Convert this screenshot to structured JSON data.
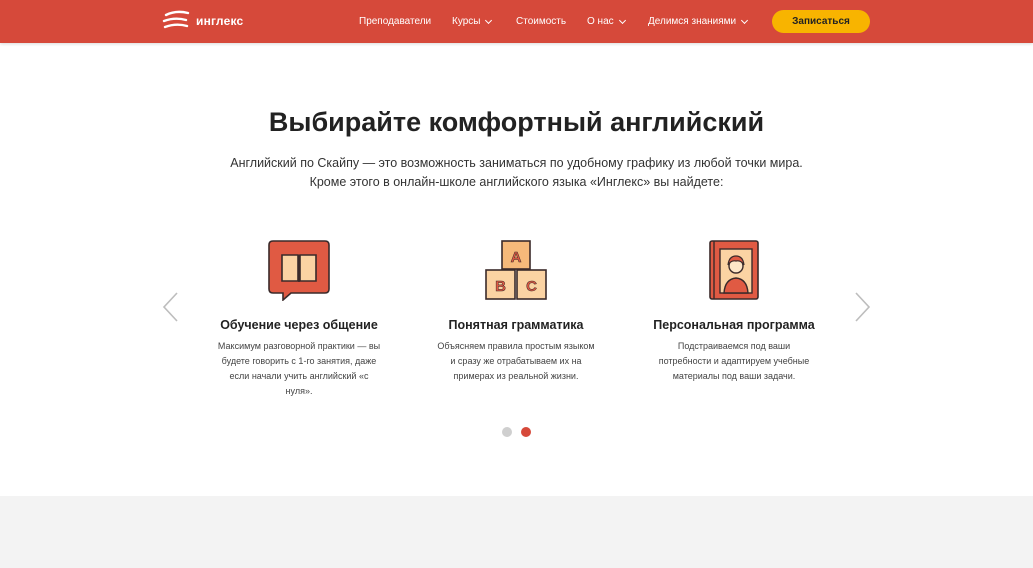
{
  "header": {
    "logo_text": "инглекс",
    "nav": {
      "teachers": "Преподаватели",
      "courses": "Курсы",
      "price": "Стоимость",
      "about": "О нас",
      "share": "Делимся знаниями"
    },
    "cta": "Записаться"
  },
  "main": {
    "title": "Выбирайте комфортный английский",
    "lead_line1": "Английский по Скайпу — это возможность заниматься по удобному графику из любой точки мира.",
    "lead_line2": "Кроме этого в онлайн-школе английского языка «Инглекс» вы найдете:"
  },
  "cards": [
    {
      "title": "Обучение через общение",
      "desc": "Максимум разговорной практики — вы будете говорить с 1-го занятия, даже если начали учить английский «с нуля»."
    },
    {
      "title": "Понятная грамматика",
      "desc": "Объясняем правила простым языком и сразу же отрабатываем их на примерах из реальной жизни."
    },
    {
      "title": "Персональная программа",
      "desc": "Подстраиваемся под ваши потребности и адаптируем учебные материалы под ваши задачи."
    }
  ],
  "blocks": {
    "a": "A",
    "b": "B",
    "c": "C"
  },
  "carousel": {
    "total_pages": 2,
    "active_page": 2
  },
  "colors": {
    "brand": "#d6493a",
    "cta": "#f8b400",
    "icon_fill": "#e05a43",
    "icon_light": "#fbd3a3",
    "dot_inactive": "#cfcfcf"
  },
  "icons": [
    "logo-icon",
    "chevron-down-icon",
    "chevron-left-icon",
    "chevron-right-icon",
    "book-chat-icon",
    "abc-blocks-icon",
    "profile-book-icon"
  ]
}
